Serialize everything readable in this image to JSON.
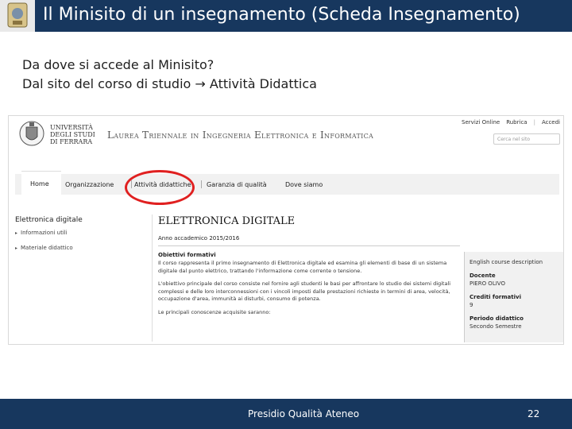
{
  "slide": {
    "title": "Il Minisito di un insegnamento (Scheda Insegnamento)",
    "intro_line1": "Da dove si accede al Minisito?",
    "intro_line2": "Dal sito del corso di studio → Attività Didattica",
    "footer": "Presidio Qualità Ateneo",
    "page_number": "22"
  },
  "site": {
    "university_line1": "UNIVERSITÀ",
    "university_line2": "DEGLI STUDI",
    "university_line3": "DI FERRARA",
    "course_title": "Laurea Triennale in Ingegneria Elettronica e Informatica",
    "top_links": [
      "Servizi Online",
      "Rubrica",
      "Accedi"
    ],
    "search_placeholder": "Cerca nel sito",
    "nav": {
      "home": "Home",
      "organizzazione": "Organizzazione",
      "attivita": "Attività didattiche",
      "garanzia": "Garanzia di qualità",
      "dove": "Dove siamo"
    },
    "sidebar": {
      "title": "Elettronica digitale",
      "items": [
        "Informazioni utili",
        "Materiale didattico"
      ]
    },
    "main": {
      "title": "ELETTRONICA DIGITALE",
      "year": "Anno accademico 2015/2016",
      "objectives_title": "Obiettivi formativi",
      "paragraph1": "Il corso rappresenta il primo insegnamento di Elettronica digitale ed esamina gli elementi di base di un sistema digitale dal punto elettrico, trattando l'informazione come corrente o tensione.",
      "paragraph2": "L'obiettivo principale del corso consiste nel fornire agli studenti le basi per affrontare lo studio dei sistemi digitali complessi e delle loro interconnessioni con i vincoli imposti dalle prestazioni richieste in termini di area, velocità, occupazione d'area, immunità ai disturbi, consumo di potenza.",
      "paragraph3": "Le principali conoscenze acquisite saranno:"
    },
    "infobox": {
      "english": "English course description",
      "docente_label": "Docente",
      "docente_value": "PIERO OLIVO",
      "crediti_label": "Crediti formativi",
      "crediti_value": "9",
      "periodo_label": "Periodo didattico",
      "periodo_value": "Secondo Semestre"
    }
  },
  "colors": {
    "header_bar": "#17375e",
    "highlight_circle": "#e02020"
  }
}
